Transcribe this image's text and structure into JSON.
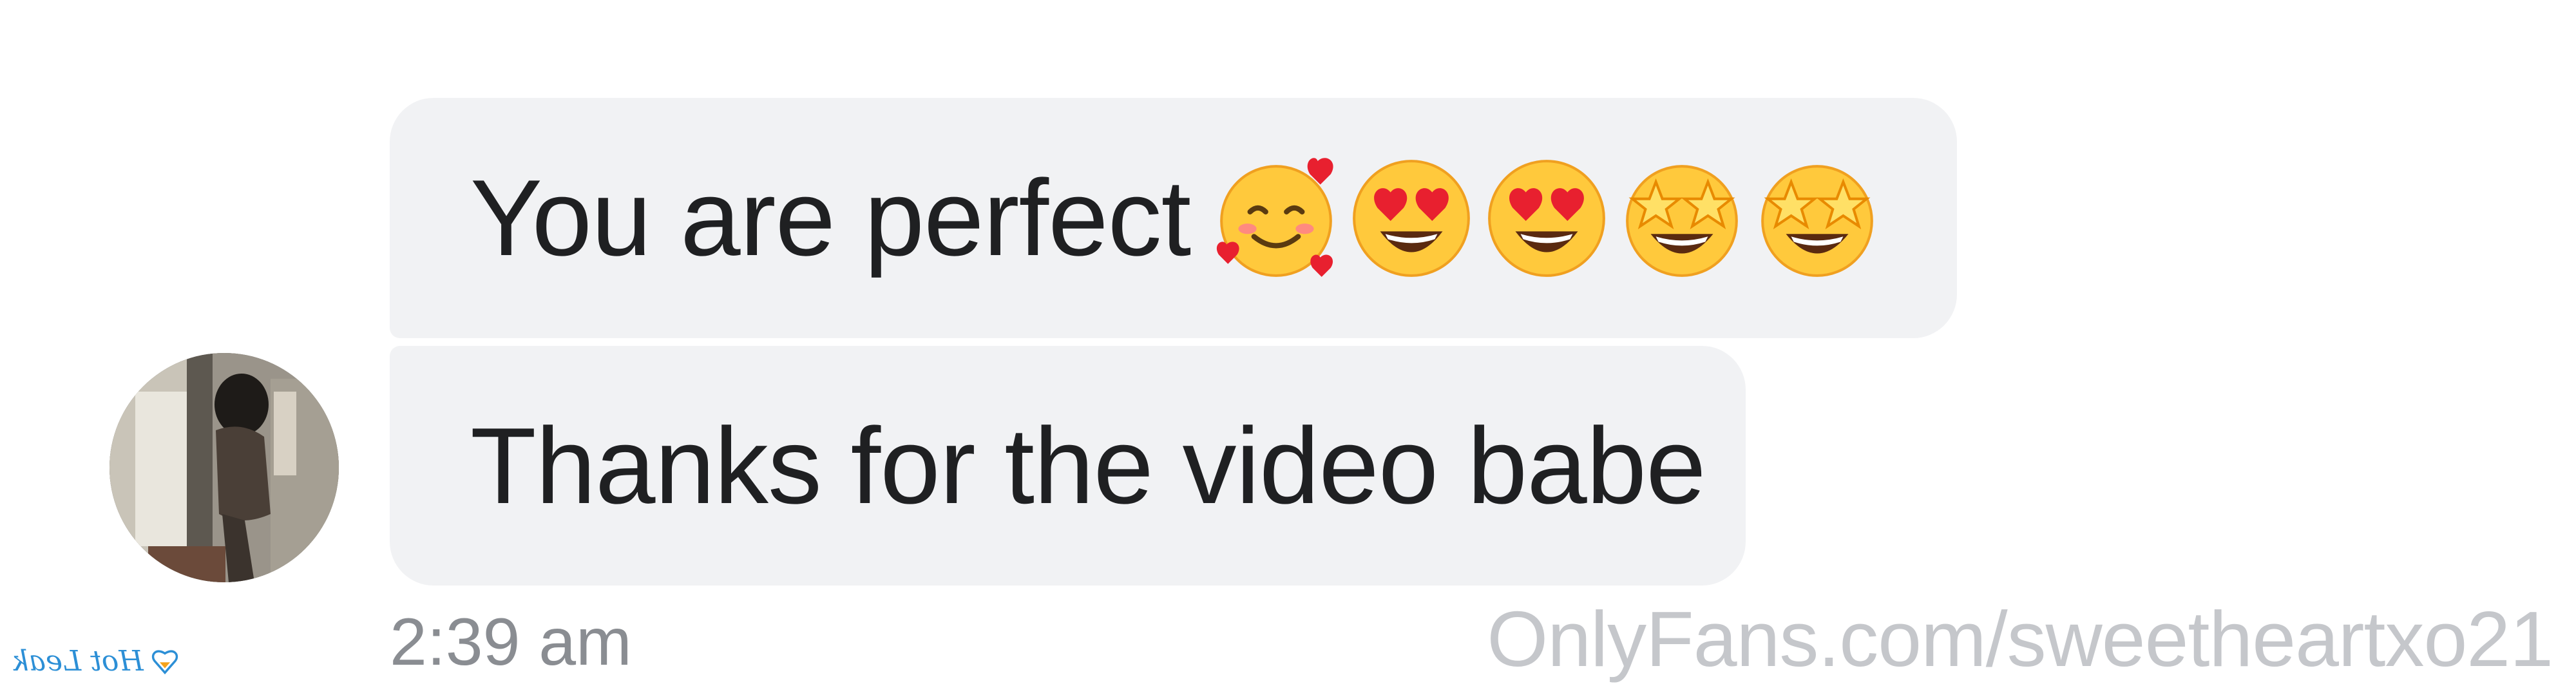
{
  "messages": [
    {
      "text": "You are perfect",
      "emojis": [
        "smiling-face-with-hearts-emoji",
        "heart-eyes-emoji",
        "heart-eyes-emoji",
        "star-struck-emoji",
        "star-struck-emoji"
      ]
    },
    {
      "text": "Thanks for the video babe",
      "emojis": []
    }
  ],
  "timestamp": "2:39 am",
  "watermark": "OnlyFans.com/sweetheartxo21",
  "logo": {
    "text": "Hot Leak",
    "color": "#2c8fd6",
    "accent_color": "#f5a21a"
  },
  "colors": {
    "bubble": "#f1f2f4",
    "text": "#1f2022",
    "timestamp": "#8a8d92",
    "watermark": "#c5c7cb"
  }
}
